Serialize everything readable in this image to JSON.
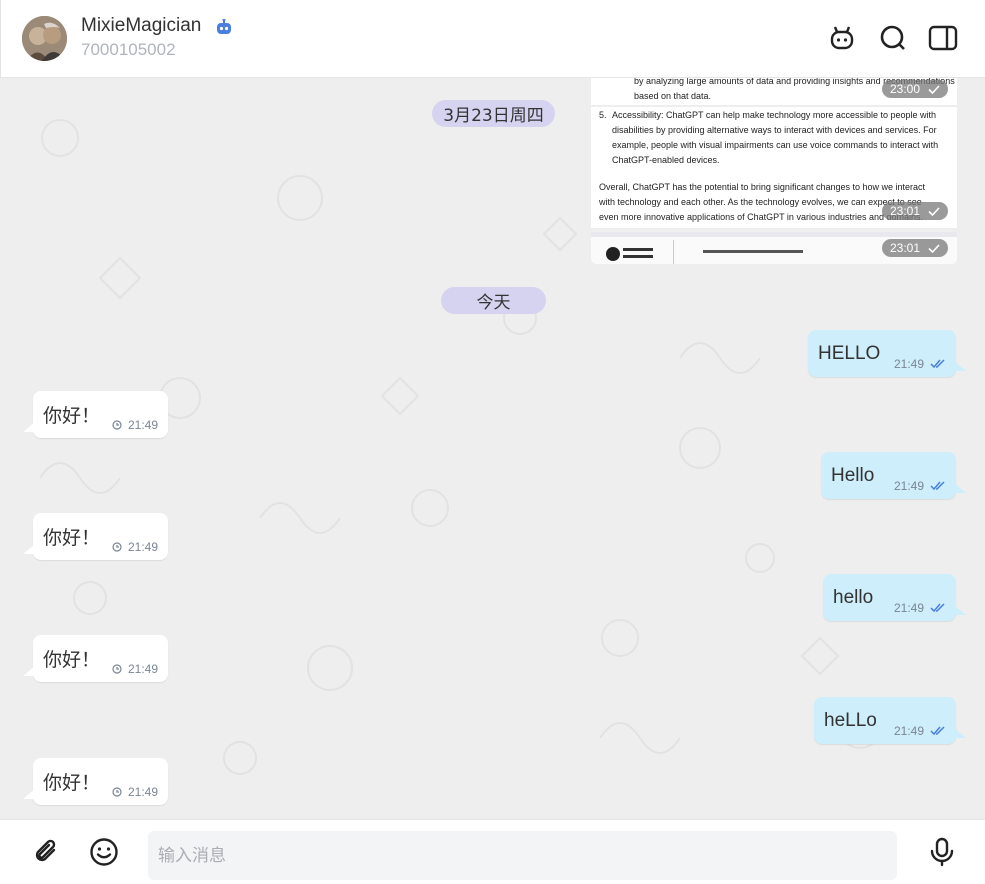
{
  "header": {
    "contact_name": "MixieMagician",
    "contact_id": "7000105002"
  },
  "dates": {
    "older": "3月23日周四",
    "today": "今天"
  },
  "image_messages": {
    "doc_line1": "by analyzing large amounts of data and providing insights and recommendations",
    "doc_line2": "based on that data.",
    "doc_item5_num": "5.",
    "doc_item5_a": "Accessibility: ChatGPT can help make technology more accessible to people with",
    "doc_item5_b": "disabilities by providing alternative ways to interact with devices and services. For",
    "doc_item5_c": "example, people with visual impairments can use voice commands to interact with",
    "doc_item5_d": "ChatGPT-enabled devices.",
    "doc_overall_a": "Overall, ChatGPT has the potential to bring significant changes to how we interact",
    "doc_overall_b": "with technology and each other. As the technology evolves, we can expect to see",
    "doc_overall_c": "even more innovative applications of ChatGPT in various industries and domains.",
    "time1": "23:00",
    "time2": "23:01",
    "time3": "23:01"
  },
  "messages": [
    {
      "dir": "out",
      "text": "HELLO",
      "time": "21:49"
    },
    {
      "dir": "in",
      "text": "你好！",
      "time": "21:49"
    },
    {
      "dir": "out",
      "text": "Hello",
      "time": "21:49"
    },
    {
      "dir": "in",
      "text": "你好！",
      "time": "21:49"
    },
    {
      "dir": "out",
      "text": "hello",
      "time": "21:49"
    },
    {
      "dir": "in",
      "text": "你好！",
      "time": "21:49"
    },
    {
      "dir": "out",
      "text": "heLLo",
      "time": "21:49"
    },
    {
      "dir": "in",
      "text": "你好！",
      "time": "21:49"
    }
  ],
  "composer": {
    "placeholder": "输入消息"
  },
  "colors": {
    "outgoing_bubble": "#cdeefa",
    "incoming_bubble": "#ffffff",
    "date_pill": "#d5d3f0",
    "accent": "#4a7fe0"
  }
}
